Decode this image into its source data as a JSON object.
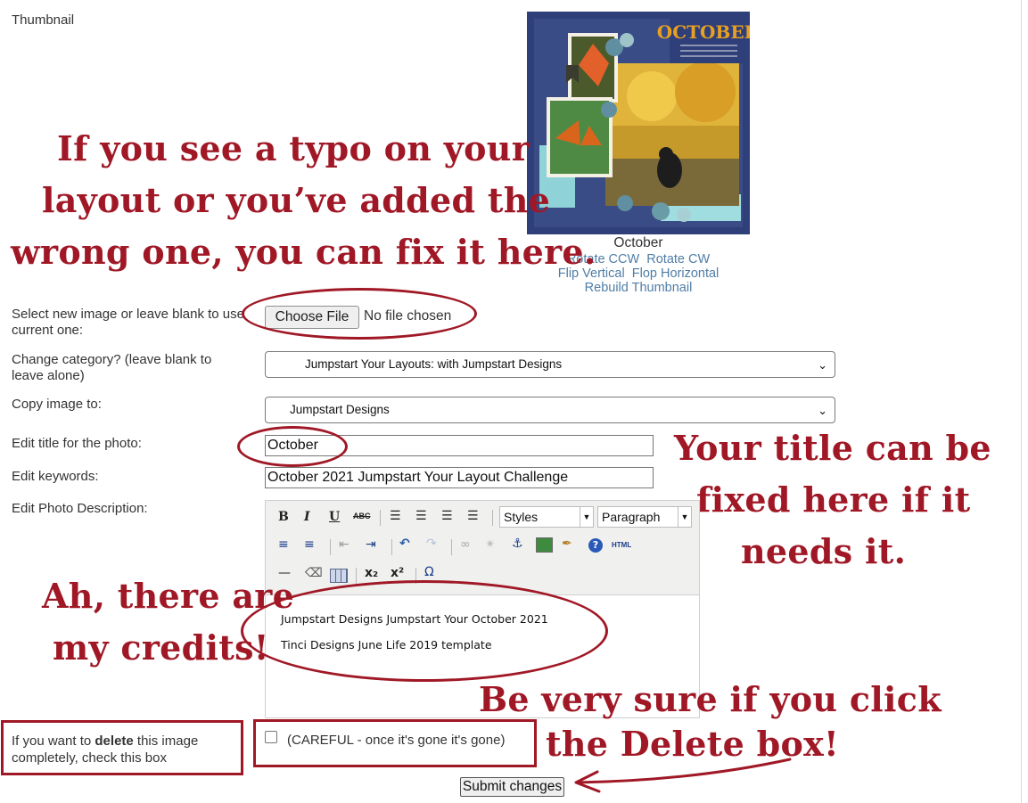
{
  "labels": {
    "thumbnail": "Thumbnail",
    "select_new_image": "Select new image or leave blank to use current one:",
    "change_category": "Change category? (leave blank to leave alone)",
    "copy_image": "Copy image to:",
    "edit_title": "Edit title for the photo:",
    "edit_keywords": "Edit keywords:",
    "edit_description": "Edit Photo Description:",
    "delete_prefix": "If you want to ",
    "delete_bold": "delete",
    "delete_suffix": " this image completely, check this box"
  },
  "thumbnail": {
    "title": "October",
    "art_text": "OCTOBER",
    "rotate_ccw": "Rotate CCW",
    "rotate_cw": "Rotate CW",
    "flip_vertical": "Flip Vertical",
    "flop_horizontal": "Flop Horizontal",
    "rebuild": "Rebuild Thumbnail"
  },
  "file_input": {
    "button": "Choose File",
    "status": "No file chosen"
  },
  "category_select": {
    "value": "Jumpstart Your Layouts: with Jumpstart Designs"
  },
  "copy_select": {
    "value": "Jumpstart Designs"
  },
  "title_input": {
    "value": "October"
  },
  "keywords_input": {
    "value": "October 2021 Jumpstart Your Layout Challenge"
  },
  "editor": {
    "styles": "Styles",
    "format": "Paragraph",
    "line1": "Jumpstart Designs Jumpstart Your October 2021",
    "line2": "Tinci Designs June Life 2019 template"
  },
  "delete_checkbox": {
    "label": "(CAREFUL - once it's gone it's gone)",
    "checked": false
  },
  "submit": {
    "label": "Submit changes"
  },
  "annotations": {
    "typo": [
      "If you see a typo on your",
      "layout or you’ve added the",
      "wrong one, you can fix it here."
    ],
    "title": [
      "Your title can be",
      "fixed here if it",
      "needs it."
    ],
    "credits": [
      "Ah, there are",
      "my credits!"
    ],
    "delete": [
      "Be very sure if you click",
      "the Delete box!"
    ]
  },
  "colors": {
    "annotation": "#a01826",
    "link": "#4f7da6"
  }
}
